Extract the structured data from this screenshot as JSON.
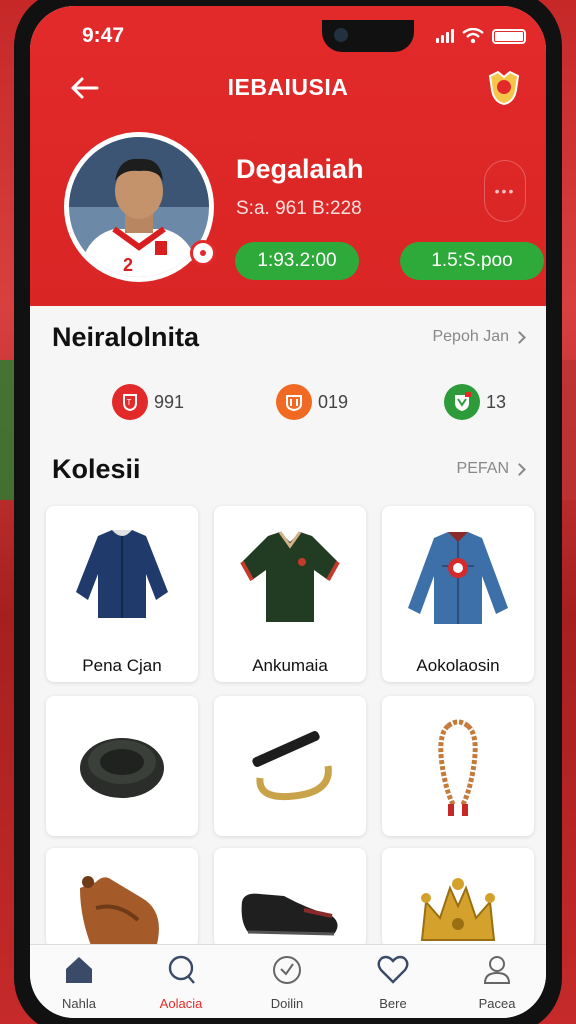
{
  "status": {
    "time": "9:47"
  },
  "header": {
    "title": "IEBAIUSIA"
  },
  "profile": {
    "name": "Degalaiah",
    "subtitle": "S:a. 961 B:228",
    "stat_primary": "1:93.2:00",
    "stat_secondary": "1.5:S.poo"
  },
  "section_stats": {
    "title": "Neiralolnita",
    "link": "Pepoh Jan",
    "items": [
      {
        "value": "991",
        "color": "#e32a2a",
        "icon": "club-crest-red-icon"
      },
      {
        "value": "019",
        "color": "#f06a23",
        "icon": "club-crest-orange-icon"
      },
      {
        "value": "13",
        "color": "#2e9b3a",
        "icon": "club-crest-green-icon"
      }
    ]
  },
  "section_collection": {
    "title": "Kolesii",
    "link": "PEFAN",
    "items": [
      {
        "label": "Pena Cjan",
        "icon": "jacket-icon"
      },
      {
        "label": "Ankumaia",
        "icon": "polo-shirt-icon"
      },
      {
        "label": "Aokolaosin",
        "icon": "denim-jacket-icon"
      },
      {
        "label": "",
        "icon": "ring-icon"
      },
      {
        "label": "",
        "icon": "bracelet-icon"
      },
      {
        "label": "",
        "icon": "chain-necklace-icon"
      },
      {
        "label": "",
        "icon": "leather-bottle-icon"
      },
      {
        "label": "",
        "icon": "shoe-icon"
      },
      {
        "label": "",
        "icon": "golden-crown-icon"
      }
    ]
  },
  "nav": [
    {
      "label": "Nahla",
      "icon": "home-icon",
      "active": false
    },
    {
      "label": "Aolacia",
      "icon": "chat-icon",
      "active": true
    },
    {
      "label": "Doilin",
      "icon": "clock-icon",
      "active": false
    },
    {
      "label": "Bere",
      "icon": "heart-icon",
      "active": false
    },
    {
      "label": "Pacea",
      "icon": "profile-icon",
      "active": false
    }
  ],
  "colors": {
    "brand_red": "#e32a2a",
    "green_pill": "#2eaa3a"
  }
}
